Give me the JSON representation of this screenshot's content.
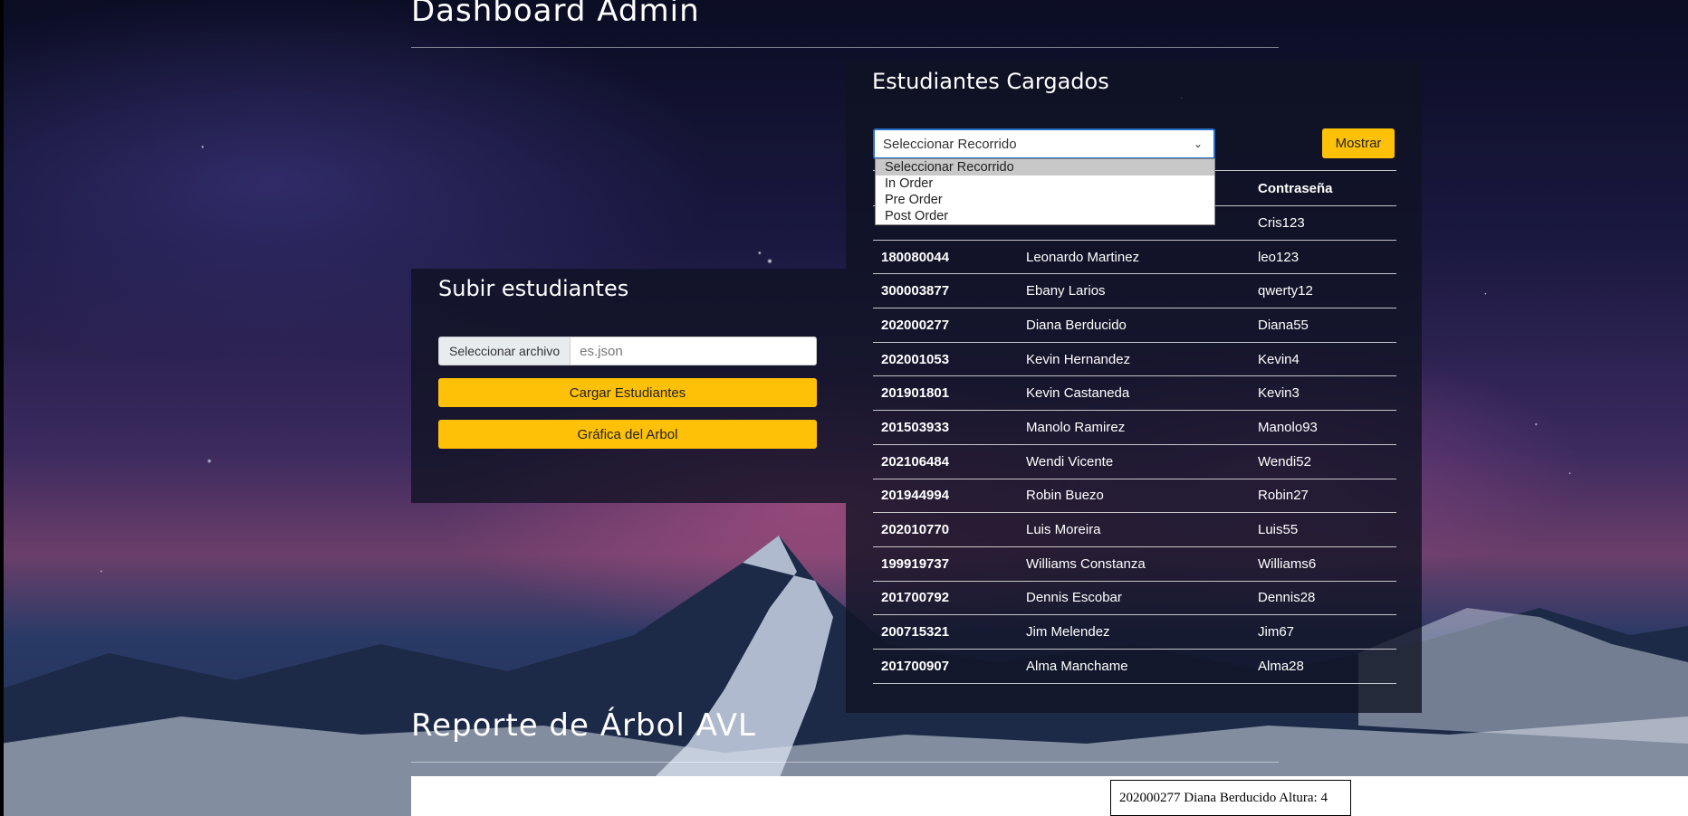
{
  "header": {
    "title": "Dashboard Admin"
  },
  "upload_panel": {
    "title": "Subir estudiantes",
    "file_button_label": "Seleccionar archivo",
    "file_name": "es.json",
    "load_button_label": "Cargar Estudiantes",
    "graph_button_label": "Gráfica del Arbol"
  },
  "students_panel": {
    "title": "Estudiantes Cargados",
    "select_value": "Seleccionar Recorrido",
    "dropdown_options": [
      "Seleccionar Recorrido",
      "In Order",
      "Pre Order",
      "Post Order"
    ],
    "show_button_label": "Mostrar",
    "table": {
      "columns": [
        "",
        "",
        "Contraseña"
      ],
      "rows": [
        [
          "",
          "",
          "Cris123"
        ],
        [
          "180080044",
          "Leonardo Martinez",
          "leo123"
        ],
        [
          "300003877",
          "Ebany Larios",
          "qwerty12"
        ],
        [
          "202000277",
          "Diana Berducido",
          "Diana55"
        ],
        [
          "202001053",
          "Kevin Hernandez",
          "Kevin4"
        ],
        [
          "201901801",
          "Kevin Castaneda",
          "Kevin3"
        ],
        [
          "201503933",
          "Manolo Ramirez",
          "Manolo93"
        ],
        [
          "202106484",
          "Wendi Vicente",
          "Wendi52"
        ],
        [
          "201944994",
          "Robin Buezo",
          "Robin27"
        ],
        [
          "202010770",
          "Luis Moreira",
          "Luis55"
        ],
        [
          "199919737",
          "Williams Constanza",
          "Williams6"
        ],
        [
          "201700792",
          "Dennis Escobar",
          "Dennis28"
        ],
        [
          "200715321",
          "Jim Melendez",
          "Jim67"
        ],
        [
          "201700907",
          "Alma Manchame",
          "Alma28"
        ]
      ]
    }
  },
  "report": {
    "title": "Reporte de Árbol AVL",
    "root_node": "202000277 Diana Berducido Altura: 4"
  },
  "colors": {
    "accent": "#ffc107",
    "focus": "#2a6ec7"
  }
}
